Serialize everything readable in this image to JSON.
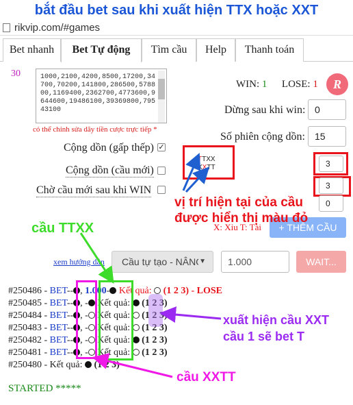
{
  "banner": {
    "text": "bắt đầu bet sau khi xuất hiện TTX hoặc XXT"
  },
  "browser": {
    "url": "rikvip.com/#games"
  },
  "tabs": [
    "Bet nhanh",
    "Bet Tự động",
    "Tìm cầu",
    "Help",
    "Thanh toán"
  ],
  "bet_auto": {
    "counter": "30",
    "sequence": "1000,2100,4200,8500,17200,34700,70200,141800,286500,578800,1169400,2362700,4773600,9644600,19486100,39369800,79543100",
    "sequence_note": "có thể chỉnh sửa dãy tiền cược trực tiếp *",
    "cong_don_gap_thep": "Cộng dồn (gấp thếp)",
    "cong_don_cau_moi": "Cộng dồn (cầu mới)",
    "cho_cau_moi": "Chờ cầu mới sau khi WIN",
    "checked_mark": "✓",
    "win_label": "WIN:",
    "win_value": "1",
    "lose_label": "LOSE:",
    "lose_value": "1",
    "logo_letter": "R",
    "dung_sau_khi_win_label": "Dừng sau khi win:",
    "dung_sau_khi_win_value": "0",
    "so_phien_label": "Số phiên cộng dồn:",
    "so_phien_value": "15",
    "pattern_value_1": "3",
    "pattern_value_2": "3",
    "pattern_value_3": "0",
    "pattern_line1_red": "T",
    "pattern_line1_rest": "TXX",
    "pattern_line2_black": "X",
    "pattern_line2_red": "X",
    "pattern_line2_rest": "TT",
    "legend_text": "X: Xỉu T: Tài",
    "add_button": "+ THÊM CẦU",
    "guide_link": "xem hướng dẫn",
    "select_value": "Cầu tự tạo - NÂNG",
    "amount_value": "1.000",
    "wait_button": "WAIT..."
  },
  "history": [
    {
      "id": "#250486",
      "prefix": "BET",
      "bet": "1.000",
      "result_label": "Kết quả:",
      "dice": "(1 2 3)",
      "outcome": "- LOSE"
    },
    {
      "id": "#250485",
      "prefix": "BET",
      "result_label": "Kết quả:",
      "dice": "(1 2 3)"
    },
    {
      "id": "#250484",
      "prefix": "BET",
      "result_label": "Kết quả:",
      "dice": "(1 2 3)"
    },
    {
      "id": "#250483",
      "prefix": "BET",
      "result_label": "Kết quả:",
      "dice": "(1 2 3)"
    },
    {
      "id": "#250482",
      "prefix": "BET",
      "result_label": "Kết quả:",
      "dice": "(1 2 3)"
    },
    {
      "id": "#250481",
      "prefix": "BET",
      "result_label": "Kết quả:",
      "dice": "(1 2 3)"
    },
    {
      "id": "#250480",
      "result_label": "Kết quả:",
      "dice": "(1 2 3)"
    }
  ],
  "status": "STARTED *****",
  "annotations": {
    "current_position": "vị trí hiện tại của cầu",
    "current_position_2": "được hiển thị màu đỏ",
    "cau_ttxx": "cầu TTXX",
    "xuat_hien_xxt": "xuất hiện cầu XXT",
    "xuat_hien_xxt_2": "cầu 1 sẽ bet T",
    "cau_xxtt": "cầu XXTT"
  },
  "colors": {
    "banner": "#1a56d6",
    "annotation_red": "#e8131b",
    "annotation_green": "#3ddc2a",
    "annotation_purple": "#9b2bf0",
    "annotation_magenta": "#f018e6",
    "arrow_blue": "#1f5fd0",
    "counter_magenta": "#c020c0",
    "win_green": "#1a8a1a",
    "lose_red": "#d81a1a",
    "bet_blue": "#1a3cc8",
    "status_green": "#1a8a1a"
  }
}
